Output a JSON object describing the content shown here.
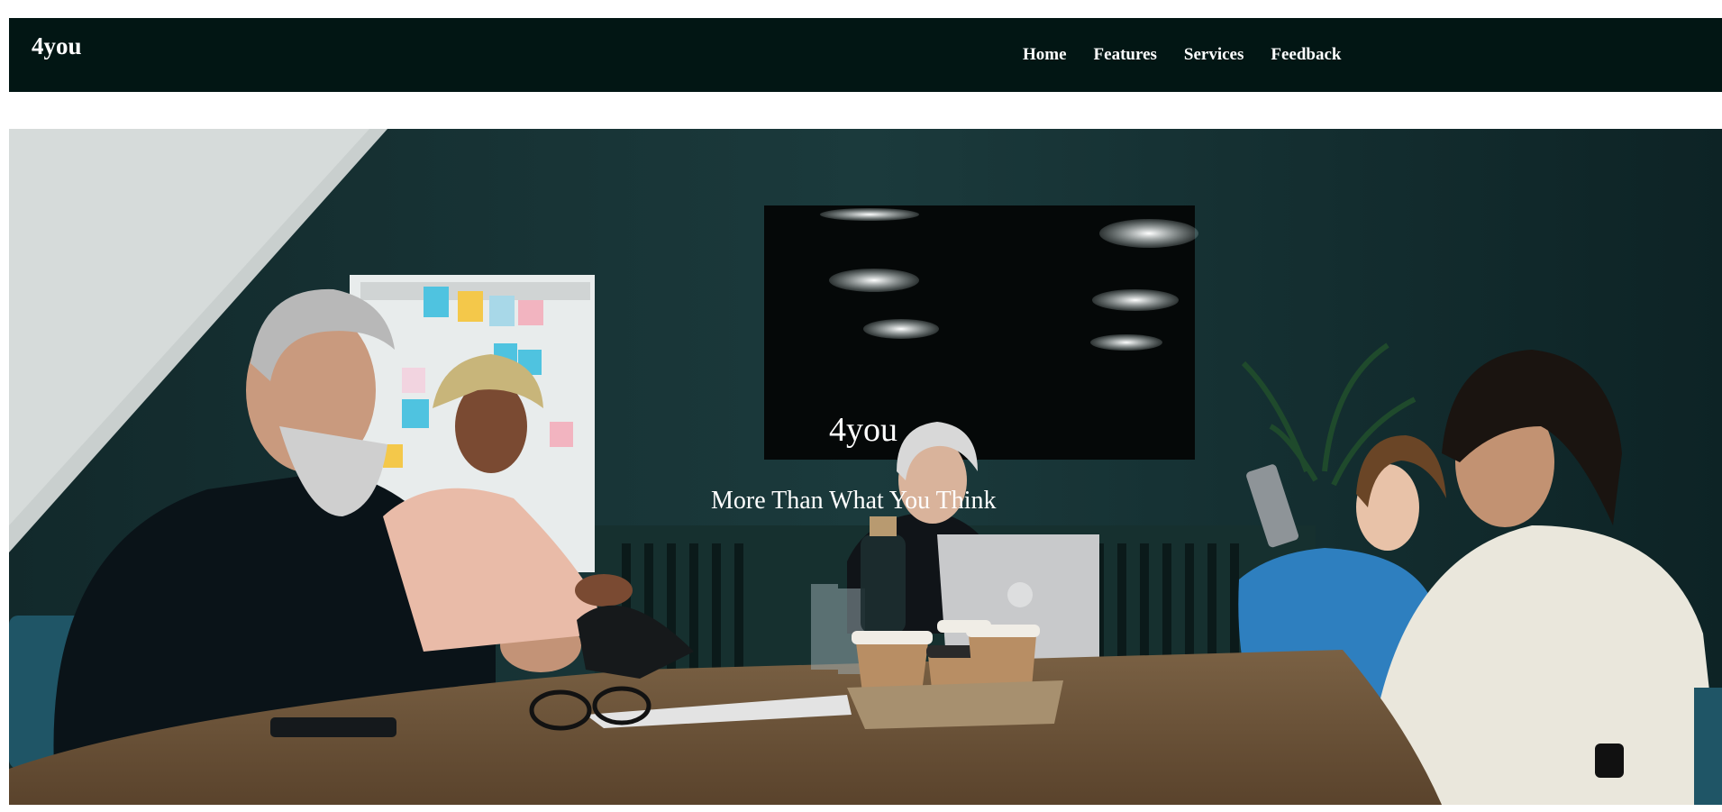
{
  "nav": {
    "brand": "4you",
    "links": [
      {
        "label": "Home"
      },
      {
        "label": "Features"
      },
      {
        "label": "Services"
      },
      {
        "label": "Feedback"
      }
    ]
  },
  "hero": {
    "title": "4you",
    "subtitle": "More Than What You Think",
    "image_description_icon": "meeting-photo",
    "colors": {
      "nav_bg": "#021614",
      "wall": "#1a3638",
      "table": "#6b5238"
    }
  }
}
